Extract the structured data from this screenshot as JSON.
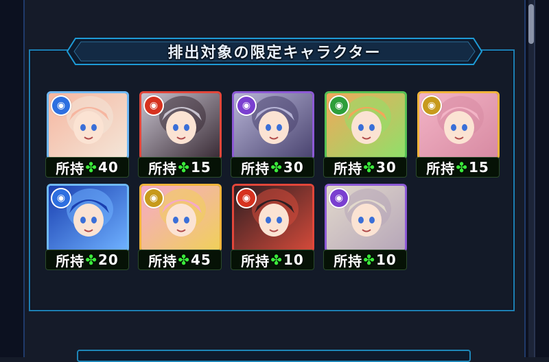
{
  "title": "排出対象の限定キャラクター",
  "owned_prefix": "所持",
  "clover_symbol": "✤",
  "colors": {
    "frame_border": "#1d7fb2",
    "count_text": "#ffffff",
    "clover": "#3bea3b"
  },
  "characters": [
    {
      "attribute": "water",
      "attr_icon": "water-icon",
      "attr_color": "#2d6fe0",
      "attr_glyph": "◉",
      "frame": "#6fb8f5",
      "bg": [
        "#f6b6a0",
        "#f3e6d8"
      ],
      "owned": "40"
    },
    {
      "attribute": "fire",
      "attr_icon": "fire-icon",
      "attr_color": "#d6321f",
      "attr_glyph": "◉",
      "frame": "#e2463a",
      "bg": [
        "#c8c3cf",
        "#3a2c36"
      ],
      "owned": "15"
    },
    {
      "attribute": "dark",
      "attr_icon": "dark-icon",
      "attr_color": "#7a3fd0",
      "attr_glyph": "◉",
      "frame": "#8d5ad6",
      "bg": [
        "#b7b4d6",
        "#4a4470"
      ],
      "owned": "30"
    },
    {
      "attribute": "wood",
      "attr_icon": "wood-icon",
      "attr_color": "#2e9e3a",
      "attr_glyph": "◉",
      "frame": "#56c054",
      "bg": [
        "#f2a75a",
        "#8fe06a"
      ],
      "owned": "30"
    },
    {
      "attribute": "light",
      "attr_icon": "light-icon",
      "attr_color": "#c79a1c",
      "attr_glyph": "◉",
      "frame": "#f0b43a",
      "bg": [
        "#f3b4c6",
        "#d78aa2"
      ],
      "owned": "15"
    },
    {
      "attribute": "water",
      "attr_icon": "water-icon",
      "attr_color": "#2d6fe0",
      "attr_glyph": "◉",
      "frame": "#6fb8f5",
      "bg": [
        "#1a3fb0",
        "#6fb1ff"
      ],
      "owned": "20"
    },
    {
      "attribute": "light",
      "attr_icon": "light-icon",
      "attr_color": "#c79a1c",
      "attr_glyph": "◉",
      "frame": "#f0b43a",
      "bg": [
        "#f5a9c8",
        "#f0d05a"
      ],
      "owned": "45"
    },
    {
      "attribute": "fire",
      "attr_icon": "fire-icon",
      "attr_color": "#d6321f",
      "attr_glyph": "◉",
      "frame": "#e2463a",
      "bg": [
        "#2d1e22",
        "#d34a3a"
      ],
      "owned": "10"
    },
    {
      "attribute": "dark",
      "attr_icon": "dark-icon",
      "attr_color": "#7a3fd0",
      "attr_glyph": "◉",
      "frame": "#8d5ad6",
      "bg": [
        "#e2d9cc",
        "#b6a6b8"
      ],
      "owned": "10"
    }
  ]
}
